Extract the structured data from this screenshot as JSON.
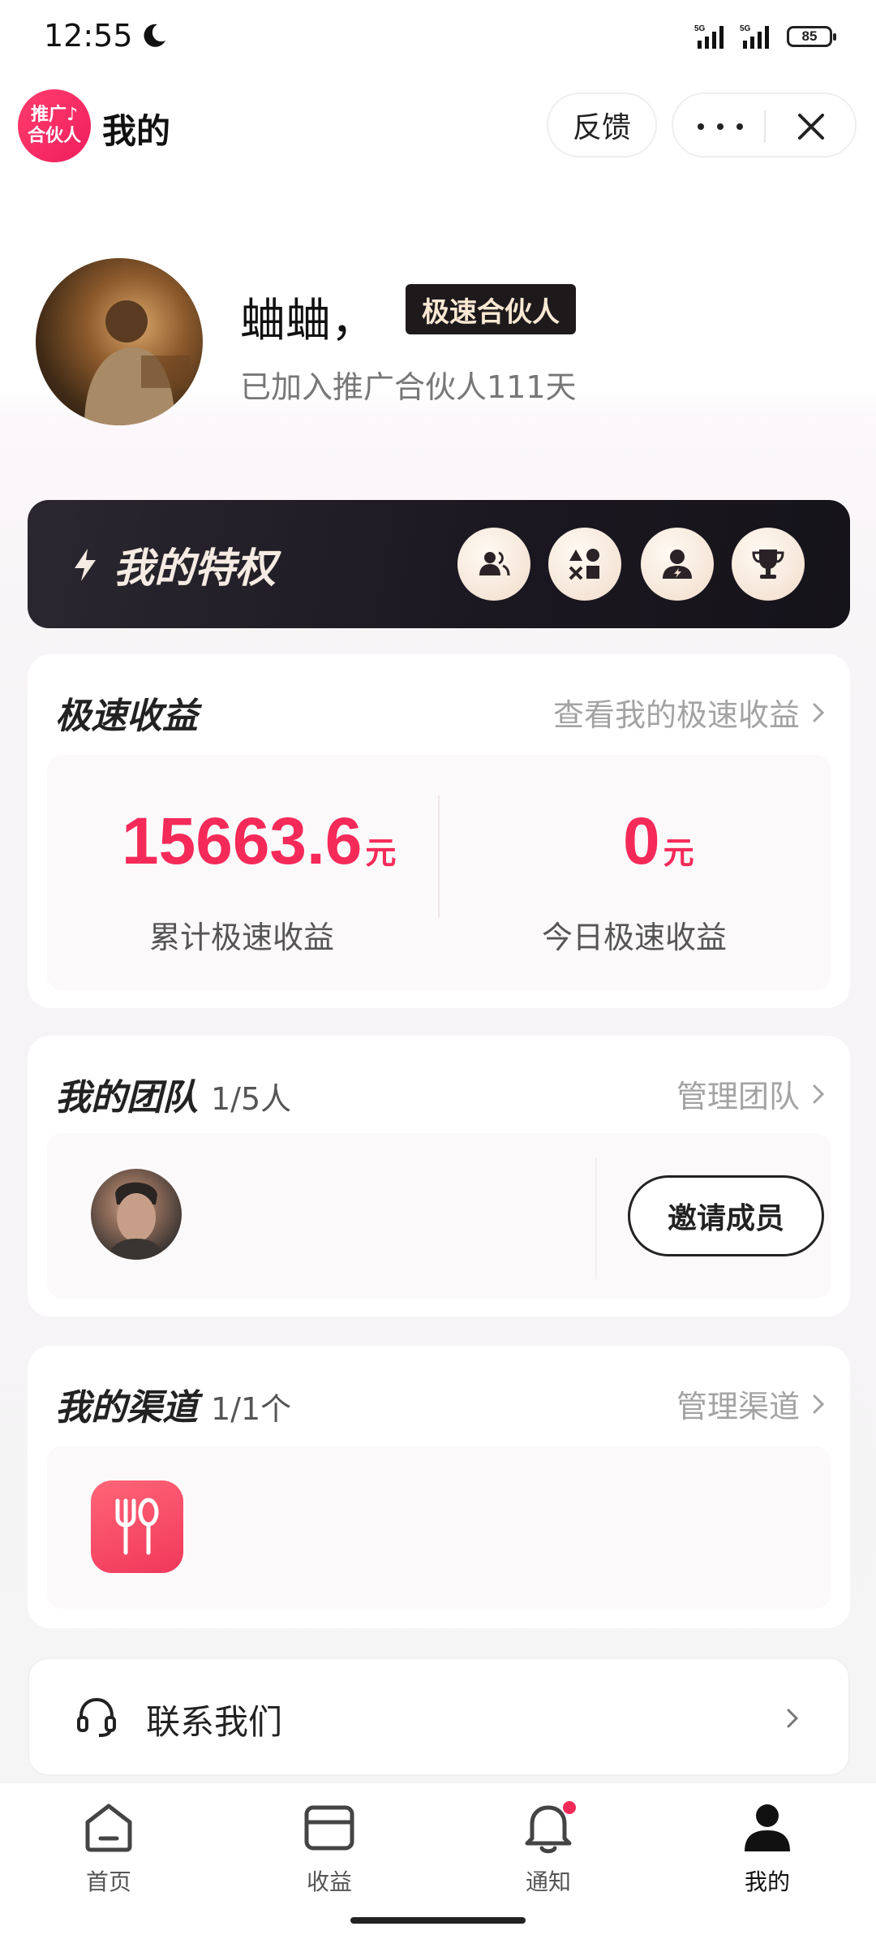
{
  "status_bar": {
    "time": "12:55",
    "battery": "85",
    "signal_labels": [
      "5G",
      "5G"
    ]
  },
  "header": {
    "logo_line1": "推广♪",
    "logo_line2": "合伙人",
    "title": "我的",
    "feedback_label": "反馈"
  },
  "profile": {
    "name": "蛐蛐，",
    "badge": "极速合伙人",
    "joined": "已加入推广合伙人111天"
  },
  "privilege": {
    "title": "我的特权",
    "icons": [
      "team-icon",
      "category-icon",
      "agent-icon",
      "trophy-icon"
    ]
  },
  "earnings": {
    "title": "极速收益",
    "link": "查看我的极速收益",
    "total_value": "15663.6",
    "total_unit": "元",
    "total_label": "累计极速收益",
    "today_value": "0",
    "today_unit": "元",
    "today_label": "今日极速收益"
  },
  "team": {
    "title": "我的团队",
    "count": "1/5人",
    "link": "管理团队",
    "invite_label": "邀请成员"
  },
  "channels": {
    "title": "我的渠道",
    "count": "1/1个",
    "link": "管理渠道"
  },
  "contact": {
    "label": "联系我们"
  },
  "bottom_nav": {
    "items": [
      {
        "label": "首页",
        "icon": "home-icon"
      },
      {
        "label": "收益",
        "icon": "wallet-icon"
      },
      {
        "label": "通知",
        "icon": "bell-icon"
      },
      {
        "label": "我的",
        "icon": "person-icon"
      }
    ],
    "active_index": 3
  },
  "colors": {
    "accent": "#f52a59",
    "dark_card": "#1e1a1c"
  }
}
